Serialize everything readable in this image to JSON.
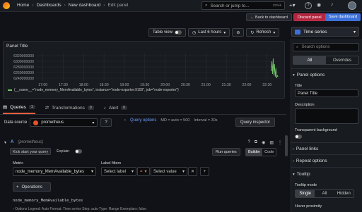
{
  "topbar": {
    "crumbs": [
      "Home",
      "Dashboards",
      "New dashboard",
      "Edit panel"
    ],
    "search_placeholder": "Search or jump to...",
    "search_shortcut": "ctrl+k"
  },
  "actions": {
    "back": "← Back to dashboard",
    "discard": "Discard panel",
    "save": "Save dashboard"
  },
  "panelbar": {
    "table_view": "Table view",
    "time_range": "Last 6 hours",
    "refresh": "Refresh"
  },
  "panel": {
    "title": "Panel Title",
    "legend": "{__name__=\"node_memory_MemAvailable_bytes\", instance=\"node-exporter:9100\", job=\"node-exporter\"}"
  },
  "chart_data": {
    "type": "line",
    "y_ticks": [
      "6320000000",
      "6300000000",
      "6280000000",
      "6260000000",
      "6240000000"
    ],
    "x_ticks": [
      "17:00",
      "17:30",
      "18:00",
      "18:30",
      "19:00",
      "19:30",
      "20:00",
      "20:30",
      "21:00",
      "21:30",
      "22:00",
      "22:30"
    ],
    "ylim": [
      6230000000,
      6330000000
    ],
    "series": [
      {
        "color": "#73bf69",
        "x": [
          "22:36",
          "22:37",
          "22:38",
          "22:39",
          "22:40",
          "22:41",
          "22:42",
          "22:43",
          "22:44",
          "22:45",
          "22:46"
        ],
        "values": [
          6265000000,
          6300000000,
          6255000000,
          6310000000,
          6250000000,
          6290000000,
          6245000000,
          6275000000,
          6240000000,
          6250000000,
          6245000000
        ]
      }
    ]
  },
  "query_tabs": [
    {
      "label": "Queries",
      "count": "1"
    },
    {
      "label": "Transformations",
      "count": "0"
    },
    {
      "label": "Alert",
      "count": "0"
    }
  ],
  "datasource": {
    "label": "Data source",
    "value": "prometheus",
    "query_options": "Query options",
    "md": "MD = auto = 500",
    "interval": "Interval = 30s",
    "inspector": "Query inspector"
  },
  "query": {
    "ref": "A",
    "source": "(prometheus)",
    "kick_start": "Kick start your query",
    "explain": "Explain",
    "run": "Run queries",
    "builder": "Builder",
    "code": "Code",
    "metric_label": "Metric",
    "metric_value": "node_memory_MemAvailable_bytes",
    "filters_label": "Label filters",
    "select_label": "Select label",
    "operator": "=",
    "select_value": "Select value",
    "operations": "Operations",
    "raw": "node_memory_MemAvailable_bytes",
    "options_line": "Options   Legend: Auto   Format: Time series   Step: auto   Type: Range   Exemplars: false"
  },
  "sidebar": {
    "viz": "Time series",
    "search_placeholder": "Search options",
    "tabs": [
      "All",
      "Overrides"
    ],
    "panel_options": "Panel options",
    "title_label": "Title",
    "title_value": "Panel Title",
    "desc_label": "Description",
    "transparent_label": "Transparent background",
    "panel_links": "Panel links",
    "repeat_options": "Repeat options",
    "tooltip": "Tooltip",
    "tooltip_mode": "Tooltip mode",
    "modes": [
      "Single",
      "All",
      "Hidden"
    ],
    "hover_proximity": "Hover proximity"
  },
  "colors": {
    "accent": "#3d71d9",
    "danger": "#b3263f",
    "series": "#73bf69",
    "tab_active": "#f55f3e"
  }
}
